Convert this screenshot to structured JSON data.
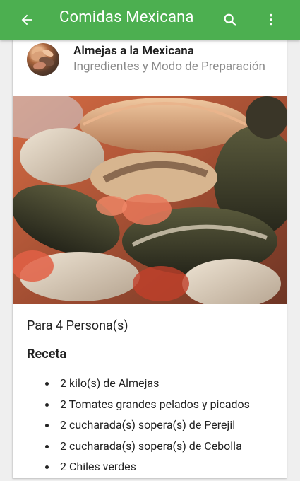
{
  "appbar": {
    "title": "Comidas Mexicana",
    "back_icon": "arrow-left-icon",
    "search_icon": "search-icon",
    "more_icon": "more-vert-icon"
  },
  "recipe": {
    "title": "Almejas a la Mexicana",
    "subtitle": "Ingredientes y Modo de Preparación",
    "servings": "Para 4 Persona(s)",
    "section_title": "Receta",
    "ingredients": [
      "2 kilo(s) de Almejas",
      "2 Tomates grandes pelados y picados",
      "2 cucharada(s) sopera(s) de Perejil",
      "2 cucharada(s) sopera(s) de Cebolla",
      "2 Chiles verdes"
    ]
  },
  "colors": {
    "primary": "#4caf50",
    "background": "#efefef",
    "card": "#ffffff"
  }
}
